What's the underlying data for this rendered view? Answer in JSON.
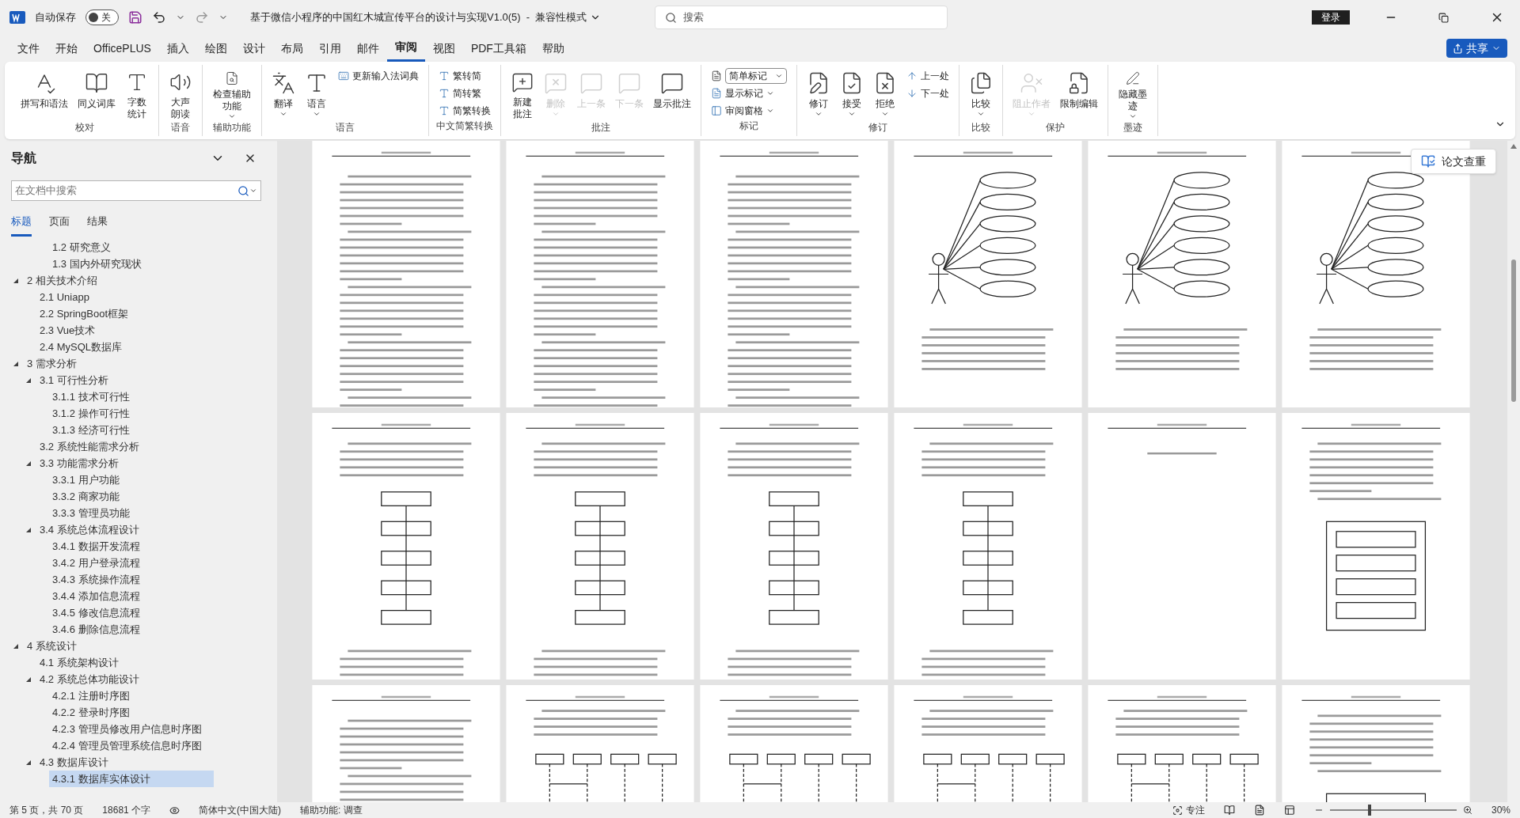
{
  "titlebar": {
    "autosave_label": "自动保存",
    "autosave": {
      "on": false,
      "label": "关"
    },
    "title": "基于微信小程序的中国红木城宣传平台的设计与实现V1.0(5)  -  兼容性模式",
    "search": {
      "placeholder": "搜索"
    },
    "login": "登录"
  },
  "menu": [
    {
      "label": "文件",
      "selected": false
    },
    {
      "label": "开始",
      "selected": false
    },
    {
      "label": "OfficePLUS",
      "selected": false
    },
    {
      "label": "插入",
      "selected": false
    },
    {
      "label": "绘图",
      "selected": false
    },
    {
      "label": "设计",
      "selected": false
    },
    {
      "label": "布局",
      "selected": false
    },
    {
      "label": "引用",
      "selected": false
    },
    {
      "label": "邮件",
      "selected": false
    },
    {
      "label": "审阅",
      "selected": true
    },
    {
      "label": "视图",
      "selected": false
    },
    {
      "label": "PDF工具箱",
      "selected": false
    },
    {
      "label": "帮助",
      "selected": false
    }
  ],
  "share": "共享",
  "ribbon": [
    {
      "label": "校对",
      "buttons": [
        {
          "kind": "large",
          "label": "拼写和语法",
          "disabled": false
        },
        {
          "kind": "large",
          "label": "同义词库",
          "disabled": false
        },
        {
          "kind": "large",
          "label": "字数统计",
          "disabled": false
        }
      ]
    },
    {
      "label": "语音",
      "buttons": [
        {
          "kind": "large",
          "label": "大声朗读",
          "disabled": false
        }
      ]
    },
    {
      "label": "辅助功能",
      "buttons": [
        {
          "kind": "large",
          "label": "检查辅助功能",
          "dropdown": true,
          "disabled": false
        }
      ]
    },
    {
      "label": "语言",
      "buttons": [
        {
          "kind": "large",
          "label": "翻译",
          "dropdown": true,
          "disabled": false
        },
        {
          "kind": "large",
          "label": "语言",
          "dropdown": true,
          "disabled": false
        },
        {
          "kind": "small",
          "label": "更新输入法词典",
          "disabled": false
        }
      ]
    },
    {
      "label": "中文简繁转换",
      "buttons": [
        {
          "kind": "small",
          "label": "繁转简",
          "disabled": false
        },
        {
          "kind": "small",
          "label": "简转繁",
          "disabled": false
        },
        {
          "kind": "small",
          "label": "简繁转换",
          "disabled": false
        }
      ]
    },
    {
      "label": "批注",
      "buttons": [
        {
          "kind": "large",
          "label": "新建批注",
          "disabled": false
        },
        {
          "kind": "large",
          "label": "删除",
          "dropdown": true,
          "disabled": true
        },
        {
          "kind": "large",
          "label": "上一条",
          "disabled": true
        },
        {
          "kind": "large",
          "label": "下一条",
          "disabled": true
        },
        {
          "kind": "large",
          "label": "显示批注",
          "disabled": false
        }
      ]
    },
    {
      "label": "标记",
      "buttons": [
        {
          "kind": "select",
          "label": "简单标记",
          "disabled": false
        },
        {
          "kind": "small",
          "label": "显示标记",
          "dropdown": true,
          "disabled": false
        },
        {
          "kind": "small",
          "label": "审阅窗格",
          "dropdown": true,
          "disabled": false
        }
      ]
    },
    {
      "label": "修订",
      "buttons": [
        {
          "kind": "large",
          "label": "修订",
          "dropdown": true,
          "disabled": false
        },
        {
          "kind": "large",
          "label": "接受",
          "dropdown": true,
          "disabled": false
        },
        {
          "kind": "large",
          "label": "拒绝",
          "dropdown": true,
          "disabled": false
        },
        {
          "kind": "small",
          "label": "上一处",
          "disabled": false
        },
        {
          "kind": "small",
          "label": "下一处",
          "disabled": false
        }
      ]
    },
    {
      "label": "比较",
      "buttons": [
        {
          "kind": "large",
          "label": "比较",
          "dropdown": true,
          "disabled": false
        }
      ]
    },
    {
      "label": "保护",
      "buttons": [
        {
          "kind": "large",
          "label": "阻止作者",
          "dropdown": true,
          "disabled": true
        },
        {
          "kind": "large",
          "label": "限制编辑",
          "disabled": false
        }
      ]
    },
    {
      "label": "墨迹",
      "buttons": [
        {
          "kind": "large",
          "label": "隐藏墨迹",
          "dropdown": true,
          "disabled": false
        }
      ]
    }
  ],
  "nav": {
    "title": "导航",
    "search": {
      "placeholder": "在文档中搜索"
    },
    "tabs": [
      {
        "label": "标题",
        "selected": true
      },
      {
        "label": "页面",
        "selected": false
      },
      {
        "label": "结果",
        "selected": false
      }
    ],
    "headings_above": [
      "1.2 研究意义",
      "1.3 国内外研究现状"
    ],
    "headings": [
      {
        "label": "2 相关技术介绍",
        "expanded": true,
        "selected": false,
        "children": [
          {
            "label": "2.1 Uniapp",
            "selected": false
          },
          {
            "label": "2.2 SpringBoot框架",
            "selected": false
          },
          {
            "label": "2.3  Vue技术",
            "selected": false
          },
          {
            "label": "2.4  MySQL数据库",
            "selected": false
          }
        ]
      },
      {
        "label": "3 需求分析",
        "expanded": true,
        "selected": false,
        "children": [
          {
            "label": "3.1 可行性分析",
            "expanded": true,
            "selected": false,
            "children": [
              {
                "label": "3.1.1 技术可行性",
                "selected": false
              },
              {
                "label": "3.1.2 操作可行性",
                "selected": false
              },
              {
                "label": "3.1.3 经济可行性",
                "selected": false
              }
            ]
          },
          {
            "label": "3.2 系统性能需求分析",
            "selected": false
          },
          {
            "label": "3.3 功能需求分析",
            "expanded": true,
            "selected": false,
            "children": [
              {
                "label": "3.3.1 用户功能",
                "selected": false
              },
              {
                "label": "3.3.2 商家功能",
                "selected": false
              },
              {
                "label": "3.3.3 管理员功能",
                "selected": false
              }
            ]
          },
          {
            "label": "3.4 系统总体流程设计",
            "expanded": true,
            "selected": false,
            "children": [
              {
                "label": "3.4.1 数据开发流程",
                "selected": false
              },
              {
                "label": "3.4.2 用户登录流程",
                "selected": false
              },
              {
                "label": "3.4.3 系统操作流程",
                "selected": false
              },
              {
                "label": "3.4.4 添加信息流程",
                "selected": false
              },
              {
                "label": "3.4.5 修改信息流程",
                "selected": false
              },
              {
                "label": "3.4.6 删除信息流程",
                "selected": false
              }
            ]
          }
        ]
      },
      {
        "label": "4 系统设计",
        "expanded": true,
        "selected": false,
        "children": [
          {
            "label": "4.1 系统架构设计",
            "selected": false
          },
          {
            "label": "4.2 系统总体功能设计",
            "expanded": true,
            "selected": false,
            "children": [
              {
                "label": "4.2.1 注册时序图",
                "selected": false
              },
              {
                "label": "4.2.2 登录时序图",
                "selected": false
              },
              {
                "label": "4.2.3 管理员修改用户信息时序图",
                "selected": false
              },
              {
                "label": "4.2.4 管理员管理系统信息时序图",
                "selected": false
              }
            ]
          },
          {
            "label": "4.3 数据库设计",
            "expanded": true,
            "selected": false,
            "children": [
              {
                "label": "4.3.1 数据库实体设计",
                "selected": true
              }
            ]
          }
        ]
      }
    ]
  },
  "pages": [
    {
      "kind": "text"
    },
    {
      "kind": "text"
    },
    {
      "kind": "text"
    },
    {
      "kind": "usecase"
    },
    {
      "kind": "usecase"
    },
    {
      "kind": "usecase"
    },
    {
      "kind": "flow"
    },
    {
      "kind": "flow"
    },
    {
      "kind": "flow"
    },
    {
      "kind": "flow"
    },
    {
      "kind": "blank"
    },
    {
      "kind": "diagram"
    },
    {
      "kind": "text"
    },
    {
      "kind": "sequence"
    },
    {
      "kind": "sequence"
    },
    {
      "kind": "sequence"
    },
    {
      "kind": "sequence"
    },
    {
      "kind": "diagram"
    }
  ],
  "check_button": "论文查重",
  "status_bar": {
    "page": "第 5 页，共 70 页",
    "words": "18681 个字",
    "language": "简体中文(中国大陆)",
    "accessibility": "辅助功能: 调查",
    "focus": "专注",
    "zoom": "30%",
    "zoom_slider": {
      "level": 0.3
    }
  }
}
